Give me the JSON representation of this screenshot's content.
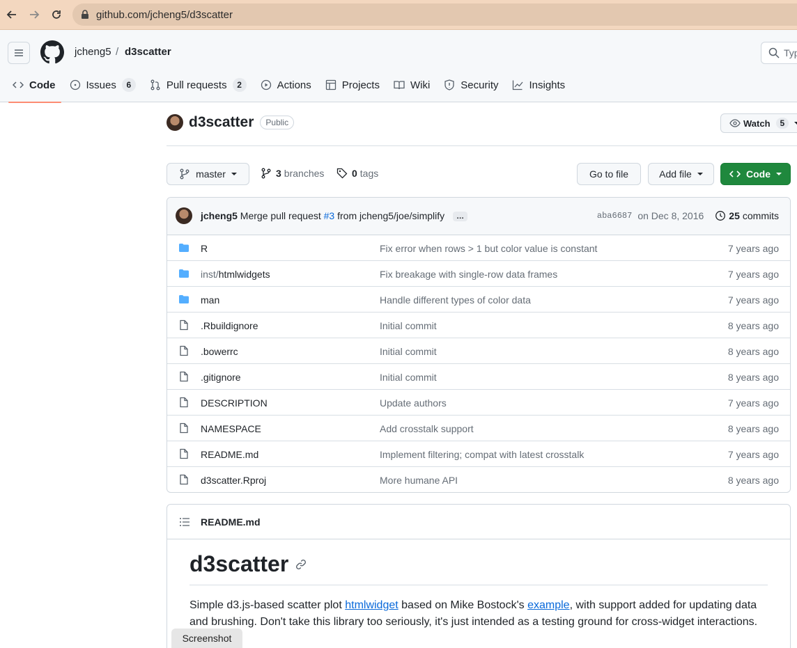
{
  "browser": {
    "url": "github.com/jcheng5/d3scatter"
  },
  "header": {
    "owner": "jcheng5",
    "separator": "/",
    "repo": "d3scatter",
    "search_placeholder": "Typ"
  },
  "repo_nav": [
    {
      "label": "Code",
      "icon": "code-icon"
    },
    {
      "label": "Issues",
      "count": "6",
      "icon": "issue-icon"
    },
    {
      "label": "Pull requests",
      "count": "2",
      "icon": "pull-request-icon"
    },
    {
      "label": "Actions",
      "icon": "play-icon"
    },
    {
      "label": "Projects",
      "icon": "table-icon"
    },
    {
      "label": "Wiki",
      "icon": "book-icon"
    },
    {
      "label": "Security",
      "icon": "shield-icon"
    },
    {
      "label": "Insights",
      "icon": "graph-icon"
    }
  ],
  "repo": {
    "name": "d3scatter",
    "visibility": "Public",
    "watch_label": "Watch",
    "watch_count": "5"
  },
  "toolbar": {
    "branch": "master",
    "branches_count": "3",
    "branches_label": "branches",
    "tags_count": "0",
    "tags_label": "tags",
    "go_to_file": "Go to file",
    "add_file": "Add file",
    "code": "Code"
  },
  "latest_commit": {
    "author": "jcheng5",
    "message_prefix": "Merge pull request",
    "pr": "#3",
    "message_suffix": "from jcheng5/joe/simplify",
    "ellipsis": "…",
    "sha": "aba6687",
    "date": "on Dec 8, 2016",
    "commits_count": "25",
    "commits_label": "commits"
  },
  "files": [
    {
      "name": "R",
      "prefix": "",
      "type": "folder",
      "message": "Fix error when rows > 1 but color value is constant",
      "age": "7 years ago"
    },
    {
      "name": "htmlwidgets",
      "prefix": "inst/",
      "type": "folder",
      "message": "Fix breakage with single-row data frames",
      "age": "7 years ago"
    },
    {
      "name": "man",
      "prefix": "",
      "type": "folder",
      "message": "Handle different types of color data",
      "age": "7 years ago"
    },
    {
      "name": ".Rbuildignore",
      "prefix": "",
      "type": "file",
      "message": "Initial commit",
      "age": "8 years ago"
    },
    {
      "name": ".bowerrc",
      "prefix": "",
      "type": "file",
      "message": "Initial commit",
      "age": "8 years ago"
    },
    {
      "name": ".gitignore",
      "prefix": "",
      "type": "file",
      "message": "Initial commit",
      "age": "8 years ago"
    },
    {
      "name": "DESCRIPTION",
      "prefix": "",
      "type": "file",
      "message": "Update authors",
      "age": "7 years ago"
    },
    {
      "name": "NAMESPACE",
      "prefix": "",
      "type": "file",
      "message": "Add crosstalk support",
      "age": "8 years ago"
    },
    {
      "name": "README.md",
      "prefix": "",
      "type": "file",
      "message": "Implement filtering; compat with latest crosstalk",
      "age": "7 years ago"
    },
    {
      "name": "d3scatter.Rproj",
      "prefix": "",
      "type": "file",
      "message": "More humane API",
      "age": "8 years ago"
    }
  ],
  "readme": {
    "file_label": "README.md",
    "heading": "d3scatter",
    "p_part1": "Simple d3.js-based scatter plot ",
    "link1": "htmlwidget",
    "p_part2": " based on Mike Bostock's ",
    "link2": "example",
    "p_part3": ", with support added for updating data and brushing. Don't take this library too seriously, it's just intended as a testing ground for cross-widget interactions."
  },
  "overlay": {
    "screenshot_label": "Screenshot"
  },
  "colors": {
    "accent_underline": "#fd8c73",
    "link": "#0969da",
    "green_button": "#1f883d",
    "folder": "#54aeff"
  }
}
